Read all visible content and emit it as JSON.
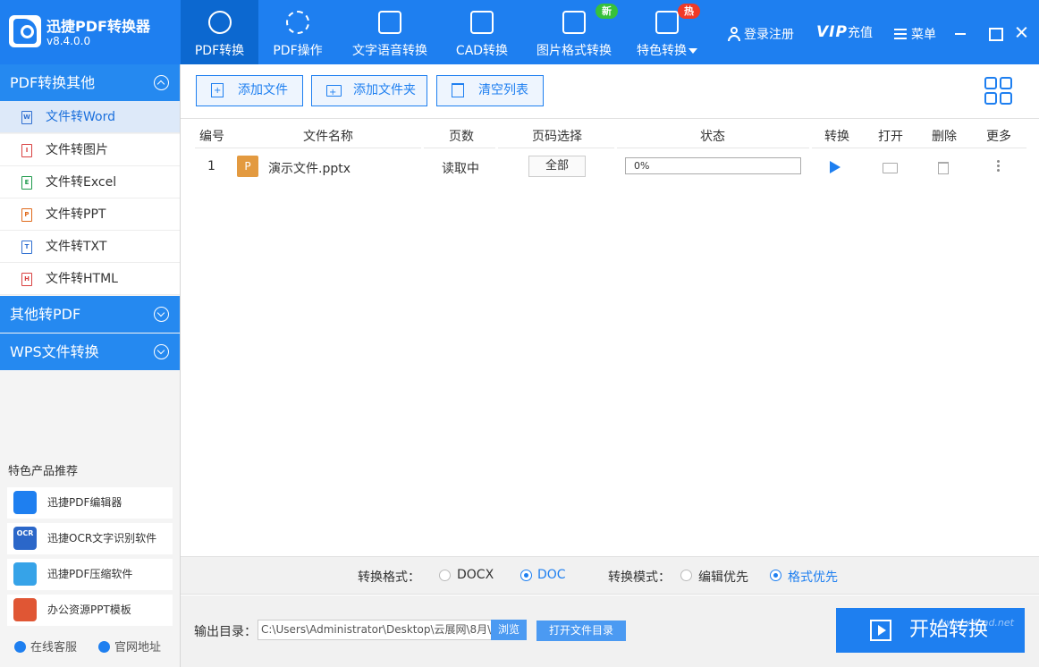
{
  "app": {
    "name": "迅捷PDF转换器",
    "version": "v8.4.0.0"
  },
  "nav": {
    "tabs": [
      {
        "label": "PDF转换",
        "icon": "convert-icon",
        "active": true
      },
      {
        "label": "PDF操作",
        "icon": "gear-icon"
      },
      {
        "label": "文字语音转换",
        "icon": "audio-wave-icon"
      },
      {
        "label": "CAD转换",
        "icon": "cad-icon"
      },
      {
        "label": "图片格式转换",
        "icon": "image-icon",
        "badge": "新"
      },
      {
        "label": "特色转换",
        "icon": "star-icon",
        "badge": "热"
      }
    ]
  },
  "topright": {
    "login": "登录注册",
    "vip": "VIP",
    "recharge": "充值",
    "menu": "菜单"
  },
  "sidebar": {
    "section1": "PDF转换其他",
    "items": [
      {
        "label": "文件转Word",
        "icon": "W",
        "active": true
      },
      {
        "label": "文件转图片",
        "icon": "I"
      },
      {
        "label": "文件转Excel",
        "icon": "E"
      },
      {
        "label": "文件转PPT",
        "icon": "P"
      },
      {
        "label": "文件转TXT",
        "icon": "T"
      },
      {
        "label": "文件转HTML",
        "icon": "H"
      }
    ],
    "section2": "其他转PDF",
    "section3": "WPS文件转换",
    "recommend_title": "特色产品推荐",
    "recommend": [
      {
        "label": "迅捷PDF编辑器"
      },
      {
        "label": "迅捷OCR文字识别软件",
        "icon_text": "OCR"
      },
      {
        "label": "迅捷PDF压缩软件"
      },
      {
        "label": "办公资源PPT模板"
      }
    ],
    "footer": {
      "service": "在线客服",
      "site": "官网地址"
    }
  },
  "toolbar": {
    "add_file": "添加文件",
    "add_folder": "添加文件夹",
    "clear_list": "清空列表"
  },
  "table": {
    "headers": [
      "编号",
      "文件名称",
      "页数",
      "页码选择",
      "状态",
      "转换",
      "打开",
      "删除",
      "更多"
    ],
    "rows": [
      {
        "index": "1",
        "file_icon": "P",
        "name": "演示文件.pptx",
        "pages": "读取中",
        "page_select": "全部",
        "progress": 0,
        "status": "0%"
      }
    ]
  },
  "format": {
    "label": "转换格式：",
    "options": [
      "DOCX",
      "DOC"
    ],
    "selected": "DOC",
    "mode_label": "转换模式：",
    "modes": [
      "编辑优先",
      "格式优先"
    ],
    "mode_selected": "格式优先"
  },
  "output": {
    "label": "输出目录：",
    "path": "C:\\Users\\Administrator\\Desktop\\云展网\\8月\\",
    "browse": "浏览",
    "open_dir": "打开文件目录"
  },
  "start_button": "开始转换",
  "watermark": "www.xdcad.net",
  "colors": {
    "primary": "#1e7ff0",
    "active_tab": "#0c68d0",
    "badge_new": "#37c13b",
    "badge_hot": "#f03a27"
  }
}
